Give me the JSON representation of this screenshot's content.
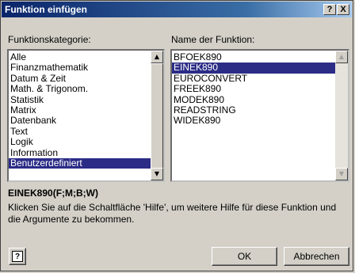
{
  "dialog": {
    "title": "Funktion einfügen",
    "help_glyph": "?",
    "close_glyph": "X"
  },
  "category": {
    "label": "Funktionskategorie:",
    "items": [
      "Alle",
      "Finanzmathematik",
      "Datum & Zeit",
      "Math. & Trigonom.",
      "Statistik",
      "Matrix",
      "Datenbank",
      "Text",
      "Logik",
      "Information",
      "Benutzerdefiniert"
    ],
    "selected": "Benutzerdefiniert"
  },
  "function": {
    "label": "Name der Funktion:",
    "items": [
      "BFOEK890",
      "EINEK890",
      "EUROCONVERT",
      "FREEK890",
      "MODEK890",
      "READSTRING",
      "WIDEK890"
    ],
    "selected": "EINEK890"
  },
  "signature": "EINEK890(F;M;B;W)",
  "description": "Klicken Sie auf die Schaltfläche 'Hilfe', um weitere Hilfe für diese Funktion und die Argumente zu bekommen.",
  "buttons": {
    "help_icon": "?",
    "ok": "OK",
    "cancel": "Abbrechen"
  },
  "colors": {
    "selection": "#2b2c86",
    "titlebar": "#0a246a"
  }
}
